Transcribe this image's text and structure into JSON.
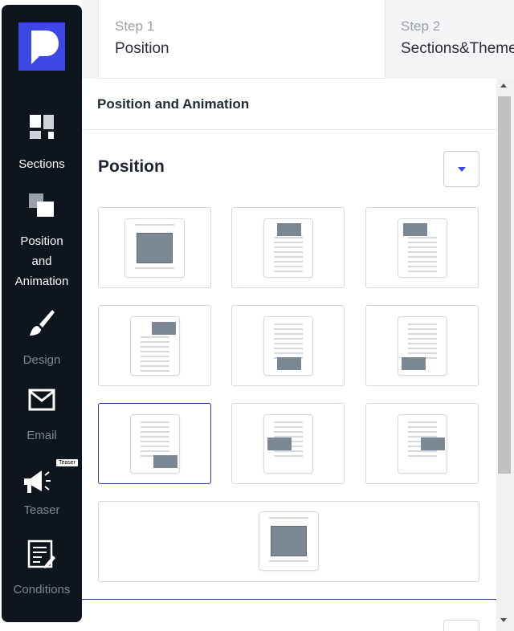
{
  "brand": {
    "logo": "brand-logo"
  },
  "sidebar": {
    "items": [
      {
        "label": "Sections",
        "icon": "sections-icon",
        "state": "normal"
      },
      {
        "label": "Position and Animation",
        "label_lines": [
          "Position",
          "and",
          "Animation"
        ],
        "icon": "position-animation-icon",
        "state": "active"
      },
      {
        "label": "Design",
        "icon": "brush-icon",
        "state": "dim"
      },
      {
        "label": "Email",
        "icon": "envelope-icon",
        "state": "dim"
      },
      {
        "label": "Teaser",
        "icon": "megaphone-icon",
        "badge": "Teaser",
        "state": "dim"
      },
      {
        "label": "Conditions",
        "icon": "checklist-icon",
        "state": "dim"
      }
    ]
  },
  "steps": [
    {
      "number": "Step 1",
      "name": "Position",
      "active": true
    },
    {
      "number": "Step 2",
      "name": "Sections&Theme",
      "active": false
    }
  ],
  "panel": {
    "header": "Position and Animation",
    "section_title": "Position",
    "collapse_icon": "caret-down-icon",
    "positions": [
      {
        "id": "center",
        "selected": false
      },
      {
        "id": "top-center",
        "selected": false
      },
      {
        "id": "top-left",
        "selected": false
      },
      {
        "id": "top-right",
        "selected": false
      },
      {
        "id": "bottom-center",
        "selected": false
      },
      {
        "id": "bottom-left",
        "selected": false
      },
      {
        "id": "bottom-right",
        "selected": true
      },
      {
        "id": "middle-left",
        "selected": false
      },
      {
        "id": "middle-right",
        "selected": false
      },
      {
        "id": "fullscreen-center",
        "selected": false
      }
    ]
  },
  "colors": {
    "sidebar_bg": "#0e151c",
    "accent": "#3a46e0",
    "selected_border": "#2b3d8f",
    "block": "#7b8893"
  }
}
